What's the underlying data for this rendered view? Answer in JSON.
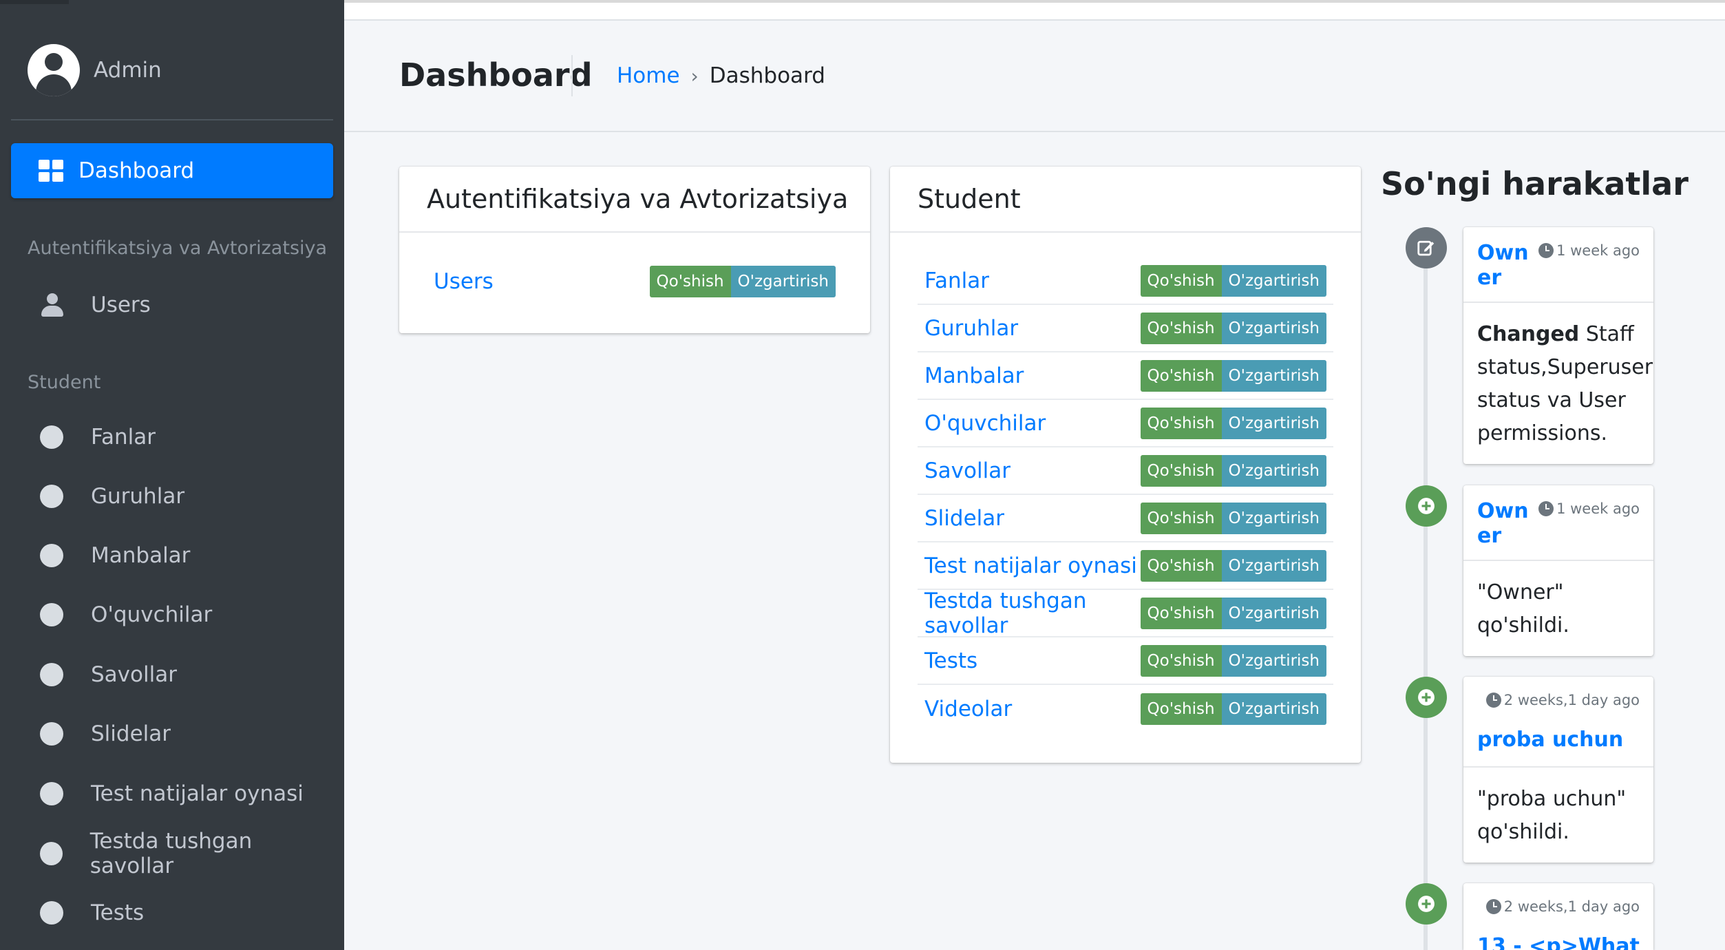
{
  "sidebar": {
    "user": "Admin",
    "active": "Dashboard",
    "groups": [
      {
        "header": "Autentifikatsiya va Avtorizatsiya",
        "items": [
          "Users"
        ]
      },
      {
        "header": "Student",
        "items": [
          "Fanlar",
          "Guruhlar",
          "Manbalar",
          "O'quvchilar",
          "Savollar",
          "Slidelar",
          "Test natijalar oynasi",
          "Testda tushgan savollar",
          "Tests"
        ]
      }
    ]
  },
  "header": {
    "title": "Dashboard",
    "breadcrumb": [
      "Home",
      "Dashboard"
    ],
    "breadcrumb_sep": "›"
  },
  "buttons": {
    "add": "Qo'shish",
    "change": "O'zgartirish"
  },
  "cards": [
    {
      "title": "Autentifikatsiya va Avtorizatsiya",
      "models": [
        "Users"
      ]
    },
    {
      "title": "Student",
      "models": [
        "Fanlar",
        "Guruhlar",
        "Manbalar",
        "O'quvchilar",
        "Savollar",
        "Slidelar",
        "Test natijalar oynasi",
        "Testda tushgan savollar",
        "Tests",
        "Videolar"
      ]
    }
  ],
  "recent": {
    "title": "So'ngi harakatlar",
    "items": [
      {
        "icon": "edit-icon",
        "author_line1": "Own",
        "author_line2": "er",
        "time": "1 week ago",
        "action": "Changed",
        "body_lines": [
          "Staff",
          "status,Superuser",
          "status va User",
          "permissions."
        ]
      },
      {
        "icon": "plus-circle-icon",
        "author_line1": "Own",
        "author_line2": "er",
        "time": "1 week ago",
        "body_lines": [
          "\"Owner\"",
          "qo'shildi."
        ]
      },
      {
        "icon": "plus-circle-icon",
        "time": "2 weeks,1 day ago",
        "link": "proba uchun",
        "body_lines": [
          "\"proba uchun\"",
          "qo'shildi."
        ]
      },
      {
        "icon": "plus-circle-icon",
        "time": "2 weeks,1 day ago",
        "link": "13 - <p>What"
      }
    ]
  },
  "colors": {
    "sidebar": "#343a40",
    "accent": "#007bff",
    "add_btn": "#5a9e58",
    "change_btn": "#4a9cb4"
  }
}
